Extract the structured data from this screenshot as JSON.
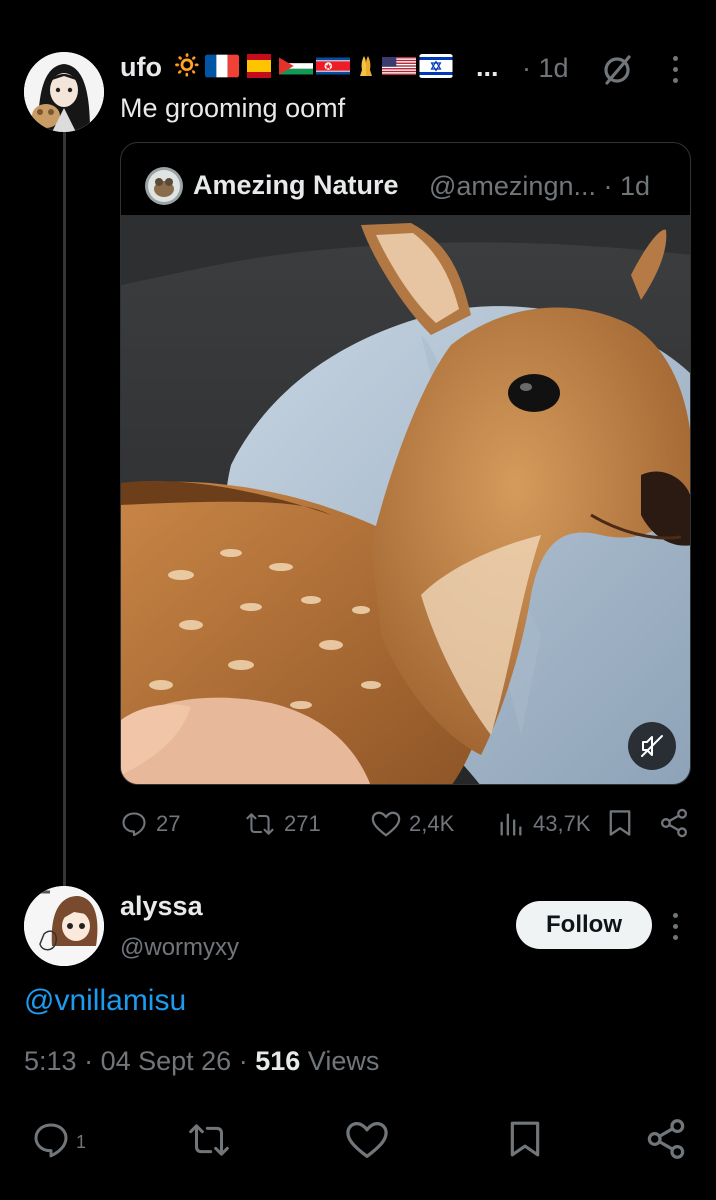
{
  "post": {
    "author_name": "ufo",
    "sun_emoji": "🔅",
    "name_ellipsis": "...",
    "time": "· 1d",
    "text": "Me grooming oomf",
    "quote": {
      "author_name": "Amezing Nature",
      "handle_time": "@amezingn... · 1d",
      "media_description": "video-thumbnail-fawn"
    },
    "actions": {
      "replies": "27",
      "reposts": "271",
      "likes": "2,4K",
      "views": "43,7K"
    }
  },
  "reply": {
    "author_name": "alyssa",
    "handle": "@wormyxy",
    "follow_label": "Follow",
    "mention": "@vnillamisu",
    "time": "5:13",
    "date": "04 Sept 26",
    "views_count": "516",
    "views_label": "Views",
    "reply_count": "1"
  },
  "colors": {
    "background": "#000000",
    "text": "#e7e9ea",
    "muted": "#71767b",
    "link": "#1d9bf0",
    "border": "#2f3336"
  }
}
